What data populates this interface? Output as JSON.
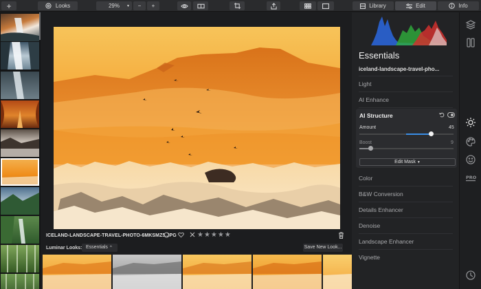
{
  "toolbar": {
    "add_label": "+",
    "looks_label": "Looks",
    "zoom_value": "29%",
    "zoom_minus": "−",
    "zoom_plus": "+",
    "tabs": [
      "Library",
      "Edit",
      "Info"
    ],
    "active_tab": "Edit"
  },
  "filmstrip": {
    "count": 10,
    "selected_index": 5
  },
  "viewer": {
    "filename": "ICELAND-LANDSCAPE-TRAVEL-PHOTO-6MKSMZ5.JPG",
    "reject_suffix": "·",
    "rating_stars": "★★★★★",
    "rating": 0
  },
  "looks_bar": {
    "label": "Luminar Looks:",
    "category": "Essentials",
    "save_button": "Save New Look..."
  },
  "panel": {
    "title": "Essentials",
    "image_name": "iceland-landscape-travel-pho...",
    "sections_above": [
      "Light",
      "AI Enhance"
    ],
    "ai_structure": {
      "title": "AI Structure",
      "amount_label": "Amount",
      "amount_value": "45",
      "amount": 0.45,
      "boost_label": "Boost",
      "boost_value": "9",
      "boost": 0.09,
      "edit_mask": "Edit Mask"
    },
    "sections_below": [
      "Color",
      "B&W Conversion",
      "Details Enhancer",
      "Denoise",
      "Landscape Enhancer",
      "Vignette"
    ]
  },
  "sidebar_icons": [
    "layers-icon",
    "adjustments-icon",
    "sun-icon",
    "palette-icon",
    "smiley-icon",
    "pro-icon",
    "history-icon"
  ],
  "colors": {
    "accent": "#3a8ee6",
    "bg": "#1b1c1e",
    "panel": "#222325"
  }
}
